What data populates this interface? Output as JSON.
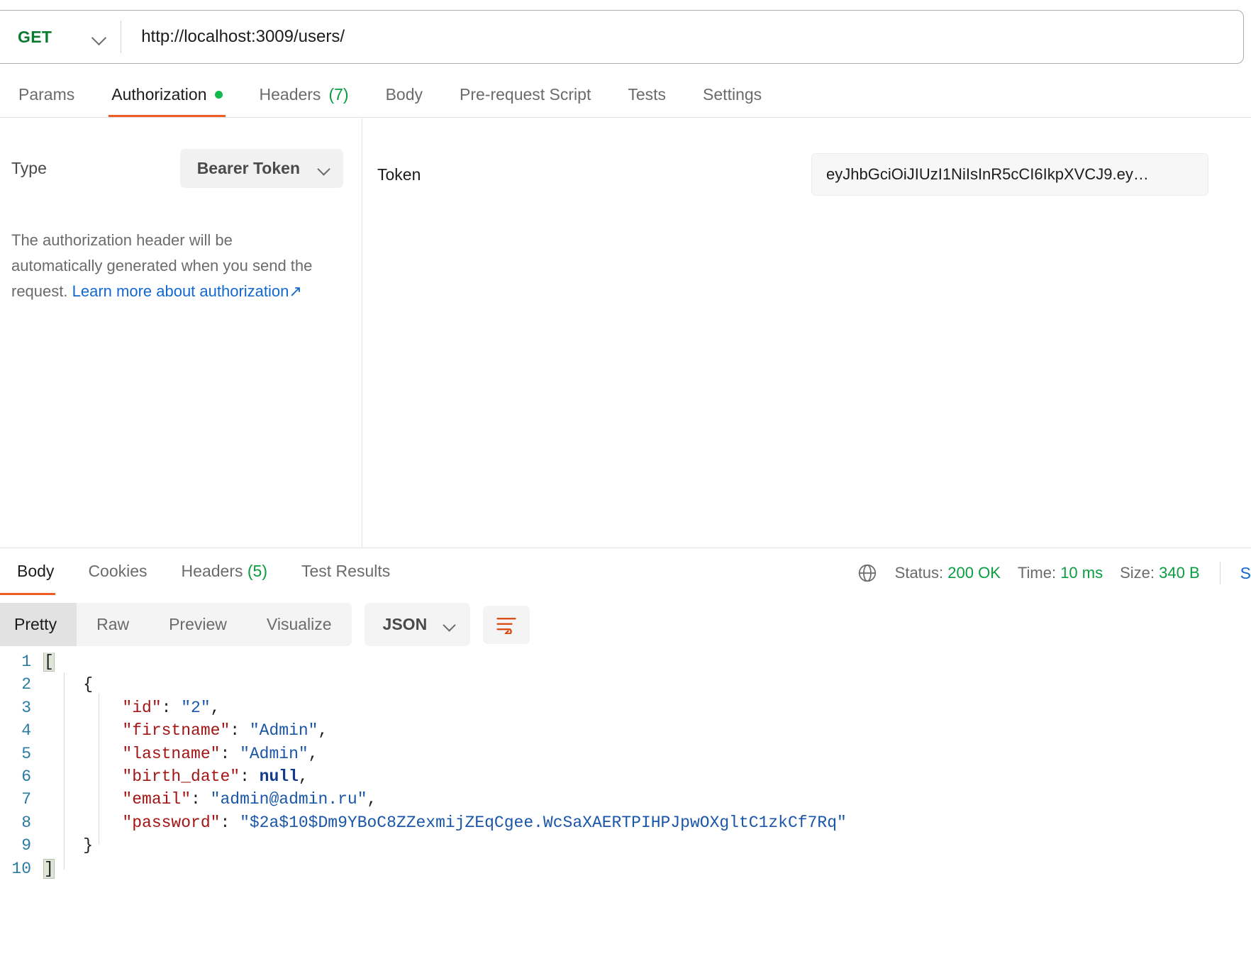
{
  "request": {
    "method": "GET",
    "url": "http://localhost:3009/users/",
    "tabs": [
      {
        "label": "Params",
        "active": false,
        "badge": "",
        "dot": false
      },
      {
        "label": "Authorization",
        "active": true,
        "badge": "",
        "dot": true
      },
      {
        "label": "Headers",
        "active": false,
        "badge": "(7)",
        "dot": false
      },
      {
        "label": "Body",
        "active": false,
        "badge": "",
        "dot": false
      },
      {
        "label": "Pre-request Script",
        "active": false,
        "badge": "",
        "dot": false
      },
      {
        "label": "Tests",
        "active": false,
        "badge": "",
        "dot": false
      },
      {
        "label": "Settings",
        "active": false,
        "badge": "",
        "dot": false
      }
    ]
  },
  "auth": {
    "type_label": "Type",
    "type_value": "Bearer Token",
    "help_text": "The authorization header will be automatically generated when you send the request.",
    "help_link": "Learn more about authorization",
    "help_link_arrow": "↗",
    "token_label": "Token",
    "token_value": "eyJhbGciOiJIUzI1NiIsInR5cCI6IkpXVCJ9.ey…",
    "token_placeholder": "Token"
  },
  "response": {
    "tabs": [
      {
        "label": "Body",
        "active": true,
        "badge": ""
      },
      {
        "label": "Cookies",
        "active": false,
        "badge": ""
      },
      {
        "label": "Headers",
        "active": false,
        "badge": "(5)"
      },
      {
        "label": "Test Results",
        "active": false,
        "badge": ""
      }
    ],
    "status_label": "Status:",
    "status_value": "200 OK",
    "time_label": "Time:",
    "time_value": "10 ms",
    "size_label": "Size:",
    "size_value": "340 B",
    "save_label": "S",
    "view_modes": [
      {
        "label": "Pretty",
        "active": true
      },
      {
        "label": "Raw",
        "active": false
      },
      {
        "label": "Preview",
        "active": false
      },
      {
        "label": "Visualize",
        "active": false
      }
    ],
    "format": "JSON",
    "wrap_icon": "wrap-lines-icon",
    "globe_icon": "globe-icon"
  },
  "code": {
    "lines": [
      {
        "no": "1",
        "segments": [
          {
            "t": "[",
            "c": "brk"
          }
        ]
      },
      {
        "no": "2",
        "segments": [
          {
            "t": "    {",
            "c": "p"
          }
        ]
      },
      {
        "no": "3",
        "segments": [
          {
            "t": "        ",
            "c": "p"
          },
          {
            "t": "\"id\"",
            "c": "k"
          },
          {
            "t": ": ",
            "c": "p"
          },
          {
            "t": "\"2\"",
            "c": "s"
          },
          {
            "t": ",",
            "c": "p"
          }
        ]
      },
      {
        "no": "4",
        "segments": [
          {
            "t": "        ",
            "c": "p"
          },
          {
            "t": "\"firstname\"",
            "c": "k"
          },
          {
            "t": ": ",
            "c": "p"
          },
          {
            "t": "\"Admin\"",
            "c": "s"
          },
          {
            "t": ",",
            "c": "p"
          }
        ]
      },
      {
        "no": "5",
        "segments": [
          {
            "t": "        ",
            "c": "p"
          },
          {
            "t": "\"lastname\"",
            "c": "k"
          },
          {
            "t": ": ",
            "c": "p"
          },
          {
            "t": "\"Admin\"",
            "c": "s"
          },
          {
            "t": ",",
            "c": "p"
          }
        ]
      },
      {
        "no": "6",
        "segments": [
          {
            "t": "        ",
            "c": "p"
          },
          {
            "t": "\"birth_date\"",
            "c": "k"
          },
          {
            "t": ": ",
            "c": "p"
          },
          {
            "t": "null",
            "c": "n"
          },
          {
            "t": ",",
            "c": "p"
          }
        ]
      },
      {
        "no": "7",
        "segments": [
          {
            "t": "        ",
            "c": "p"
          },
          {
            "t": "\"email\"",
            "c": "k"
          },
          {
            "t": ": ",
            "c": "p"
          },
          {
            "t": "\"admin@admin.ru\"",
            "c": "s"
          },
          {
            "t": ",",
            "c": "p"
          }
        ]
      },
      {
        "no": "8",
        "segments": [
          {
            "t": "        ",
            "c": "p"
          },
          {
            "t": "\"password\"",
            "c": "k"
          },
          {
            "t": ": ",
            "c": "p"
          },
          {
            "t": "\"$2a$10$Dm9YBoC8ZZexmijZEqCgee.WcSaXAERTPIHPJpwOXgltC1zkCf7Rq\"",
            "c": "s"
          }
        ]
      },
      {
        "no": "9",
        "segments": [
          {
            "t": "    }",
            "c": "p"
          }
        ]
      },
      {
        "no": "10",
        "segments": [
          {
            "t": "]",
            "c": "brk"
          }
        ]
      }
    ]
  }
}
